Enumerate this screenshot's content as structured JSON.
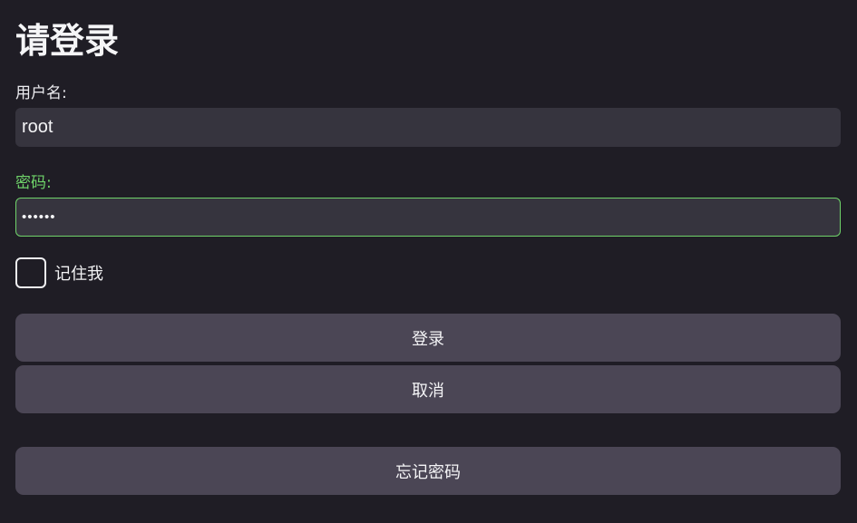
{
  "page": {
    "title": "请登录"
  },
  "form": {
    "username_label": "用户名:",
    "username_value": "root",
    "password_label": "密码:",
    "password_value": "••••••",
    "remember_label": "记住我",
    "remember_checked": false,
    "password_focused": true
  },
  "buttons": {
    "login": "登录",
    "cancel": "取消",
    "forgot_password": "忘记密码"
  },
  "colors": {
    "background": "#1f1d25",
    "field_background": "#36343e",
    "button_background": "#4b4655",
    "focus_accent": "#6fd36a"
  }
}
